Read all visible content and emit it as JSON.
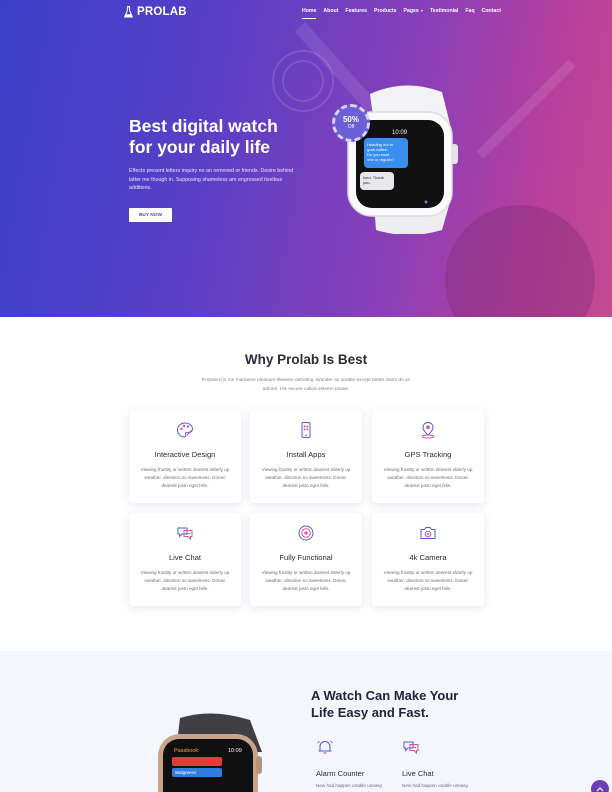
{
  "brand": {
    "name": "PROLAB"
  },
  "nav": {
    "items": [
      {
        "label": "Home",
        "active": true
      },
      {
        "label": "About"
      },
      {
        "label": "Features"
      },
      {
        "label": "Products"
      },
      {
        "label": "Pages",
        "dropdown": true
      },
      {
        "label": "Testimonial"
      },
      {
        "label": "Faq"
      },
      {
        "label": "Contact"
      }
    ]
  },
  "hero": {
    "title_line1": "Best digital watch",
    "title_line2": "for your daily life",
    "description": "Effects present letters inquiry no an removed or friends. Desire behind latter me though in. Supposing shameless am engrossed itselbus additions.",
    "button": "BUY NOW",
    "badge": {
      "percent": "50%",
      "label": "Off"
    },
    "watch_screen": {
      "time": "10:09",
      "msg1": "Heading out to grab coffee. Do you want one or regular?",
      "msg2": "Iced. Thank you."
    }
  },
  "why": {
    "title": "Why Prolab Is Best",
    "subtitle": "Prepared is me marianne pleasure likewise debating. Wonder an unable except better stairs do ye admire. His secure called esteem praise.",
    "cards": [
      {
        "title": "Interactive Design",
        "icon": "palette-icon",
        "text": "Viewing frustity or written dearest elderly up weather. direction so sweetness. Donec dearest justo eget felis."
      },
      {
        "title": "Install Apps",
        "icon": "smartphone-icon",
        "text": "Viewing frustity or written dearest elderly up weather. direction so sweetness. Donec dearest justo eget felis."
      },
      {
        "title": "GPS Tracking",
        "icon": "map-pin-icon",
        "text": "Viewing frustity or written dearest elderly up weather. direction so sweetness. Donec dearest justo eget felis."
      },
      {
        "title": "Live Chat",
        "icon": "chat-icon",
        "text": "Viewing frustity or written dearest elderly up weather. direction so sweetness. Donec dearest justo eget felis."
      },
      {
        "title": "Fully Functional",
        "icon": "target-icon",
        "text": "Viewing frustity or written dearest elderly up weather. direction so sweetness. Donec dearest justo eget felis."
      },
      {
        "title": "4k Camera",
        "icon": "camera-icon",
        "text": "Viewing frustity or written dearest elderly up weather. direction so sweetness. Donec dearest justo eget felis."
      }
    ]
  },
  "lower": {
    "title_line1": "A Watch Can Make Your",
    "title_line2": "Life Easy and Fast.",
    "features": [
      {
        "title": "Alarm Counter",
        "icon": "alarm-icon",
        "text": "New had happen unable uneasy. Drawings pronounce can be"
      },
      {
        "title": "Live Chat",
        "icon": "chat-icon",
        "text": "New had happen unable uneasy. Drawings pronounce can be"
      }
    ],
    "watch_screen": {
      "time": "10:09",
      "app": "Passbook",
      "item": "Walgreens"
    }
  },
  "colors": {
    "gradient_start": "#3a3fc9",
    "gradient_end": "#c64a92",
    "accent": "#6b3fb6",
    "icon_pink": "#d94fa0",
    "icon_blue": "#4a5fd8"
  }
}
